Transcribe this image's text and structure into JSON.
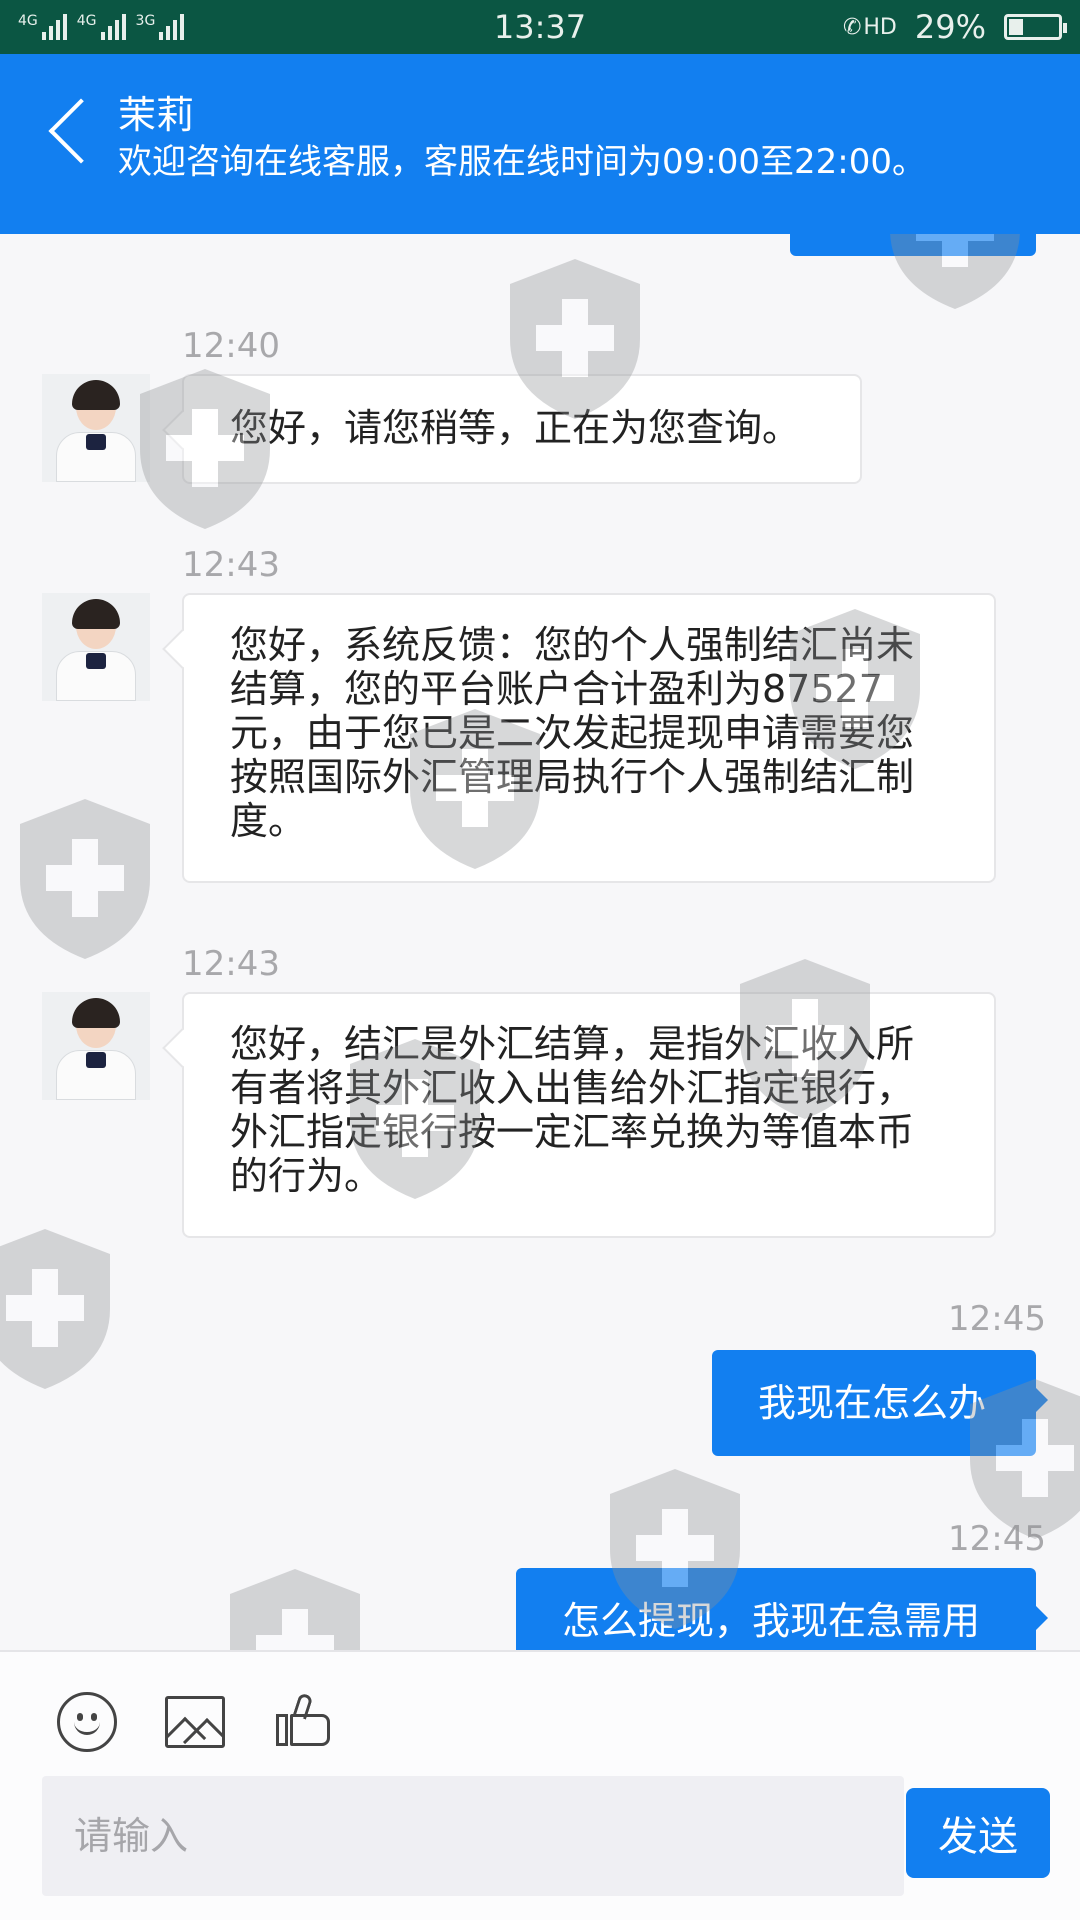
{
  "status_bar": {
    "network_1": "4G",
    "network_2": "4G",
    "network_3": "3G",
    "time": "13:37",
    "call_badge": "HD",
    "battery_percent": "29%",
    "battery_level": 0.29
  },
  "header": {
    "agent_name": "茉莉",
    "subtitle": "欢迎咨询在线客服，客服在线时间为09:00至22:00。"
  },
  "messages": [
    {
      "time": "12:40",
      "direction": "in",
      "text": "您好，请您稍等，正在为您查询。"
    },
    {
      "time": "12:43",
      "direction": "in",
      "text": "您好，系统反馈：您的个人强制结汇尚未结算，您的平台账户合计盈利为87527元，由于您已是二次发起提现申请需要您按照国际外汇管理局执行个人强制结汇制度。"
    },
    {
      "time": "12:43",
      "direction": "in",
      "text": "您好，结汇是外汇结算，是指外汇收入所有者将其外汇收入出售给外汇指定银行，外汇指定银行按一定汇率兑换为等值本币的行为。"
    },
    {
      "time": "12:45",
      "direction": "out",
      "text": "我现在怎么办"
    },
    {
      "time": "12:45",
      "direction": "out",
      "text": "怎么提现，我现在急需用"
    }
  ],
  "input": {
    "placeholder": "请输入",
    "send_label": "发送"
  },
  "colors": {
    "accent": "#127ff0",
    "status_bar": "#0b5643"
  },
  "icons": [
    "back-icon",
    "emoji-icon",
    "image-icon",
    "thumbs-up-icon",
    "shield-watermark-icon"
  ]
}
